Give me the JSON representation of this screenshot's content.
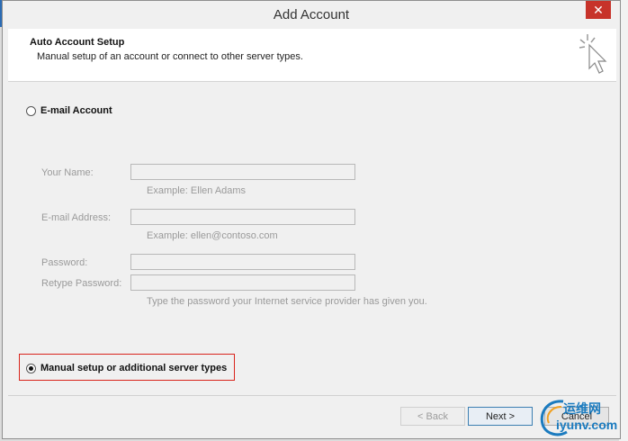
{
  "window": {
    "title": "Add Account",
    "close_symbol": "✕"
  },
  "header": {
    "title": "Auto Account Setup",
    "subtitle": "Manual setup of an account or connect to other server types.",
    "icon": "cursor-sparkle-icon"
  },
  "email_option": {
    "label": "E-mail Account",
    "selected": false
  },
  "fields": {
    "name": {
      "label": "Your Name:",
      "value": "",
      "hint": "Example: Ellen Adams"
    },
    "email": {
      "label": "E-mail Address:",
      "value": "",
      "hint": "Example: ellen@contoso.com"
    },
    "password": {
      "label": "Password:",
      "value": ""
    },
    "retype": {
      "label": "Retype Password:",
      "value": "",
      "hint": "Type the password your Internet service provider has given you."
    }
  },
  "manual_option": {
    "label": "Manual setup or additional server types",
    "selected": true
  },
  "buttons": {
    "back": "< Back",
    "next": "Next >",
    "cancel": "Cancel"
  },
  "watermark": {
    "line1": "运维网",
    "line2": "iyunv.com"
  },
  "colors": {
    "close_button": "#c7332a",
    "highlight_box": "#d9241c",
    "watermark": "#1b7bbf"
  }
}
